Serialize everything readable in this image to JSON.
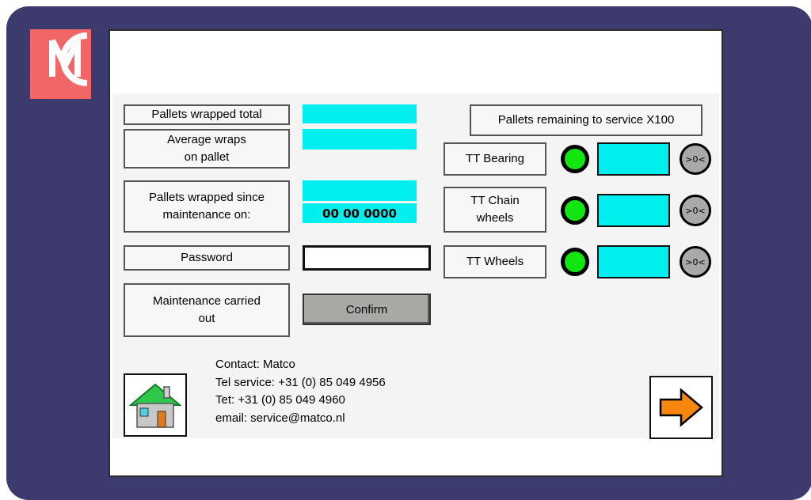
{
  "branding": {
    "logo_letter": "M",
    "logo_color": "#f26667",
    "bezel_color": "#3d3a6e"
  },
  "labels": {
    "pallets_total": "Pallets wrapped total",
    "average_wraps": "Average wraps\non pallet",
    "since_maintenance": "Pallets wrapped since\nmaintenance on:",
    "password": "Password",
    "maintenance_done": "Maintenance carried\nout",
    "remaining_header": "Pallets remaining to service X100"
  },
  "values": {
    "pallets_total": "",
    "average_wraps": "",
    "since_maintenance": "",
    "maintenance_date": "00 00  0000",
    "password": ""
  },
  "buttons": {
    "confirm": "Confirm"
  },
  "service_items": [
    {
      "label": "TT Bearing",
      "value": "",
      "reset_label": ">0<",
      "status_color": "#11e611"
    },
    {
      "label": "TT Chain\nwheels",
      "value": "",
      "reset_label": ">0<",
      "status_color": "#11e611"
    },
    {
      "label": "TT Wheels",
      "value": "",
      "reset_label": ">0<",
      "status_color": "#11e611"
    }
  ],
  "contact": {
    "line1": "Contact: Matco",
    "line2": "Tel service: +31 (0) 85 049 4956",
    "line3": "Tet: +31 (0) 85 049 4960",
    "line4": "email: service@matco.nl"
  },
  "nav": {
    "home_icon": "home-icon",
    "next_icon": "arrow-right-icon"
  },
  "colors": {
    "value_field": "#00eeee",
    "status_ok": "#11e611",
    "arrow": "#f7860f"
  }
}
